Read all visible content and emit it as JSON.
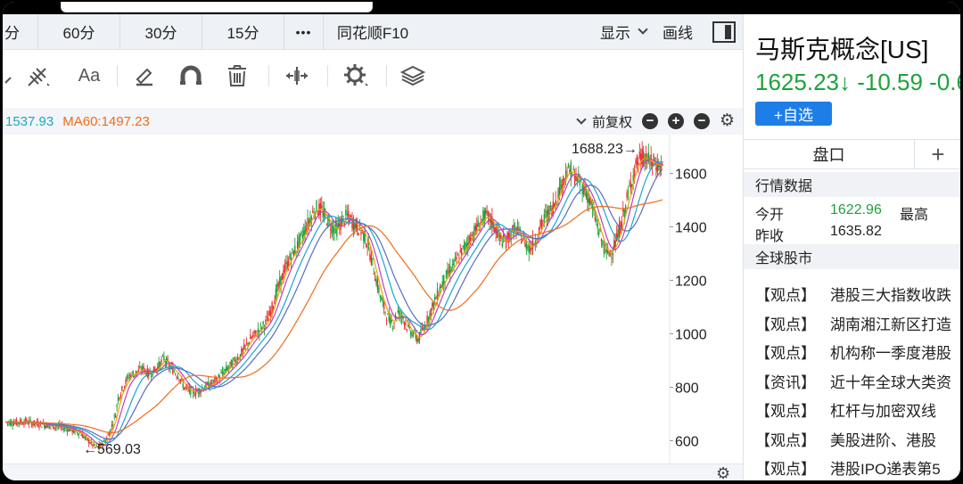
{
  "periods": [
    "分",
    "60分",
    "30分",
    "15分",
    "•••",
    "同花顺F10"
  ],
  "toolbar_right": {
    "display_label": "显示",
    "draw_label": "画线"
  },
  "tools_text": {
    "font_tool": "Aa"
  },
  "ma": {
    "ma20": "1537.93",
    "ma60": "MA60:1497.23"
  },
  "chart_controls": {
    "adjust_label": "前复权",
    "zoom_out": "−",
    "zoom_in": "+",
    "minus": "−"
  },
  "chart_data": {
    "type": "candlestick",
    "y_ticks": [
      600,
      800,
      1000,
      1200,
      1400,
      1600
    ],
    "ylim": [
      515,
      1745
    ],
    "max_label": "1688.23→",
    "min_label": "←569.03",
    "max_value": 1688.23,
    "min_value": 569.03,
    "close_path": [
      [
        0,
        670
      ],
      [
        8,
        668
      ],
      [
        15,
        672
      ],
      [
        22,
        665
      ],
      [
        30,
        660
      ],
      [
        38,
        655
      ],
      [
        45,
        650
      ],
      [
        52,
        640
      ],
      [
        58,
        630
      ],
      [
        62,
        610
      ],
      [
        66,
        595
      ],
      [
        70,
        575
      ],
      [
        74,
        580
      ],
      [
        78,
        600
      ],
      [
        82,
        640
      ],
      [
        86,
        700
      ],
      [
        88,
        760
      ],
      [
        92,
        800
      ],
      [
        96,
        840
      ],
      [
        100,
        850
      ],
      [
        104,
        860
      ],
      [
        108,
        870
      ],
      [
        112,
        850
      ],
      [
        116,
        860
      ],
      [
        120,
        880
      ],
      [
        124,
        910
      ],
      [
        128,
        880
      ],
      [
        132,
        860
      ],
      [
        136,
        840
      ],
      [
        140,
        800
      ],
      [
        144,
        790
      ],
      [
        148,
        780
      ],
      [
        152,
        790
      ],
      [
        156,
        800
      ],
      [
        160,
        810
      ],
      [
        164,
        820
      ],
      [
        168,
        840
      ],
      [
        172,
        860
      ],
      [
        176,
        880
      ],
      [
        180,
        900
      ],
      [
        184,
        920
      ],
      [
        188,
        950
      ],
      [
        192,
        980
      ],
      [
        196,
        1000
      ],
      [
        200,
        1020
      ],
      [
        204,
        1040
      ],
      [
        208,
        1080
      ],
      [
        212,
        1150
      ],
      [
        216,
        1200
      ],
      [
        220,
        1250
      ],
      [
        224,
        1290
      ],
      [
        228,
        1320
      ],
      [
        232,
        1360
      ],
      [
        236,
        1400
      ],
      [
        240,
        1440
      ],
      [
        244,
        1470
      ],
      [
        248,
        1460
      ],
      [
        252,
        1430
      ],
      [
        256,
        1400
      ],
      [
        260,
        1390
      ],
      [
        264,
        1420
      ],
      [
        268,
        1440
      ],
      [
        272,
        1420
      ],
      [
        276,
        1400
      ],
      [
        280,
        1380
      ],
      [
        284,
        1340
      ],
      [
        288,
        1260
      ],
      [
        292,
        1180
      ],
      [
        296,
        1110
      ],
      [
        300,
        1060
      ],
      [
        304,
        1040
      ],
      [
        308,
        1080
      ],
      [
        312,
        1060
      ],
      [
        316,
        1020
      ],
      [
        320,
        1000
      ],
      [
        324,
        980
      ],
      [
        328,
        1020
      ],
      [
        332,
        1060
      ],
      [
        336,
        1110
      ],
      [
        340,
        1160
      ],
      [
        344,
        1200
      ],
      [
        348,
        1230
      ],
      [
        352,
        1260
      ],
      [
        356,
        1290
      ],
      [
        360,
        1320
      ],
      [
        364,
        1350
      ],
      [
        368,
        1380
      ],
      [
        372,
        1410
      ],
      [
        376,
        1440
      ],
      [
        380,
        1430
      ],
      [
        384,
        1400
      ],
      [
        388,
        1360
      ],
      [
        392,
        1340
      ],
      [
        396,
        1370
      ],
      [
        400,
        1390
      ],
      [
        404,
        1370
      ],
      [
        408,
        1340
      ],
      [
        412,
        1320
      ],
      [
        416,
        1350
      ],
      [
        420,
        1400
      ],
      [
        424,
        1440
      ],
      [
        428,
        1460
      ],
      [
        432,
        1500
      ],
      [
        436,
        1550
      ],
      [
        440,
        1600
      ],
      [
        444,
        1610
      ],
      [
        448,
        1580
      ],
      [
        452,
        1560
      ],
      [
        456,
        1530
      ],
      [
        460,
        1480
      ],
      [
        464,
        1420
      ],
      [
        468,
        1350
      ],
      [
        472,
        1300
      ],
      [
        476,
        1310
      ],
      [
        480,
        1350
      ],
      [
        484,
        1420
      ],
      [
        488,
        1500
      ],
      [
        492,
        1580
      ],
      [
        496,
        1640
      ],
      [
        500,
        1660
      ],
      [
        504,
        1650
      ],
      [
        508,
        1640
      ],
      [
        512,
        1630
      ],
      [
        516,
        1625
      ]
    ]
  },
  "stock": {
    "name": "马斯克概念[US]",
    "price_line": "1625.23↓ -10.59 -0.6",
    "add_button": "+自选"
  },
  "tabs": {
    "pankou": "盘口",
    "plus": "+"
  },
  "quote": {
    "section_title": "行情数据",
    "rows": [
      {
        "k": "今开",
        "v": "1622.96",
        "k2": "最高"
      },
      {
        "k": "昨收",
        "v": "1635.82"
      }
    ]
  },
  "global_title": "全球股市",
  "news": [
    {
      "tag": "【观点】",
      "text": "港股三大指数收跌"
    },
    {
      "tag": "【观点】",
      "text": "湖南湘江新区打造"
    },
    {
      "tag": "【观点】",
      "text": "机构称一季度港股"
    },
    {
      "tag": "【资讯】",
      "text": "近十年全球大类资"
    },
    {
      "tag": "【观点】",
      "text": "杠杆与加密双线"
    },
    {
      "tag": "【观点】",
      "text": "美股进阶、港股"
    },
    {
      "tag": "【观点】",
      "text": "港股IPO递表第5"
    }
  ],
  "colors": {
    "up": "#e8302f",
    "down": "#1ea23b",
    "ma5": "#f2a200",
    "ma10": "#c03dc8",
    "ma20": "#1aa6c8",
    "ma30": "#5a6cc0",
    "ma60": "#ef6c1a"
  }
}
